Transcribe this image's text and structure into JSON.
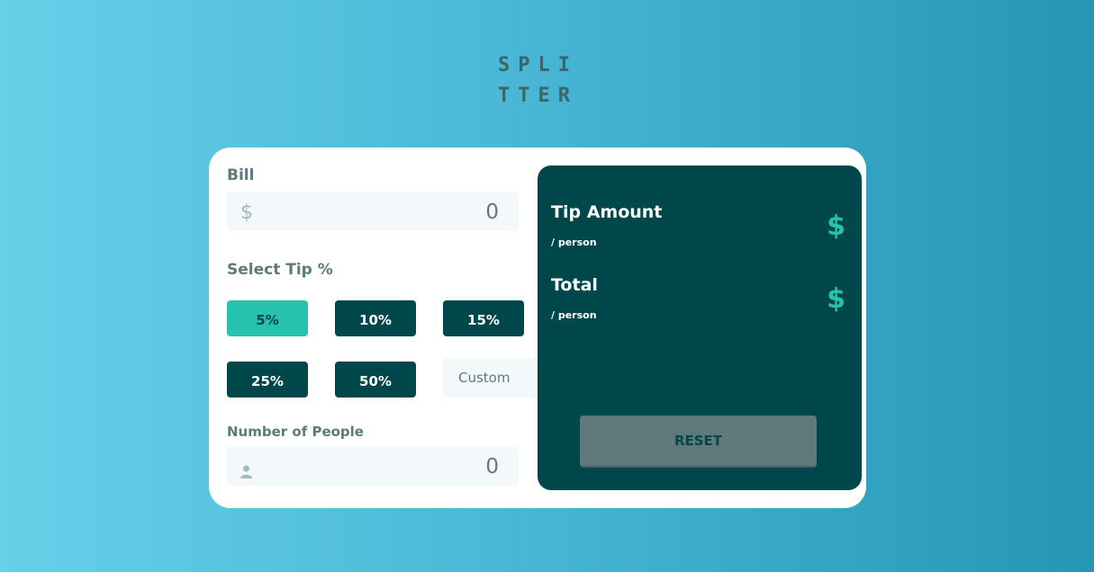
{
  "logo": {
    "line1": "SPLI",
    "line2": "TTER"
  },
  "bill": {
    "label": "Bill",
    "currency_symbol": "$",
    "value": "0"
  },
  "tip": {
    "label": "Select Tip %",
    "options": [
      "5%",
      "10%",
      "15%",
      "25%",
      "50%"
    ],
    "selected": "5%",
    "custom_placeholder": "Custom"
  },
  "people": {
    "label": "Number of People",
    "value": "0",
    "icon": "person-icon"
  },
  "results": {
    "tip_amount_label": "Tip Amount",
    "tip_amount_sub": "/ person",
    "tip_amount_value": "$",
    "total_label": "Total",
    "total_sub": "/ person",
    "total_value": "$",
    "reset_label": "RESET"
  },
  "colors": {
    "dark_cyan": "#00474b",
    "strong_cyan": "#26c2ad",
    "grayish_cyan": "#5e7a7d",
    "light_bg": "#f3f8fb"
  }
}
